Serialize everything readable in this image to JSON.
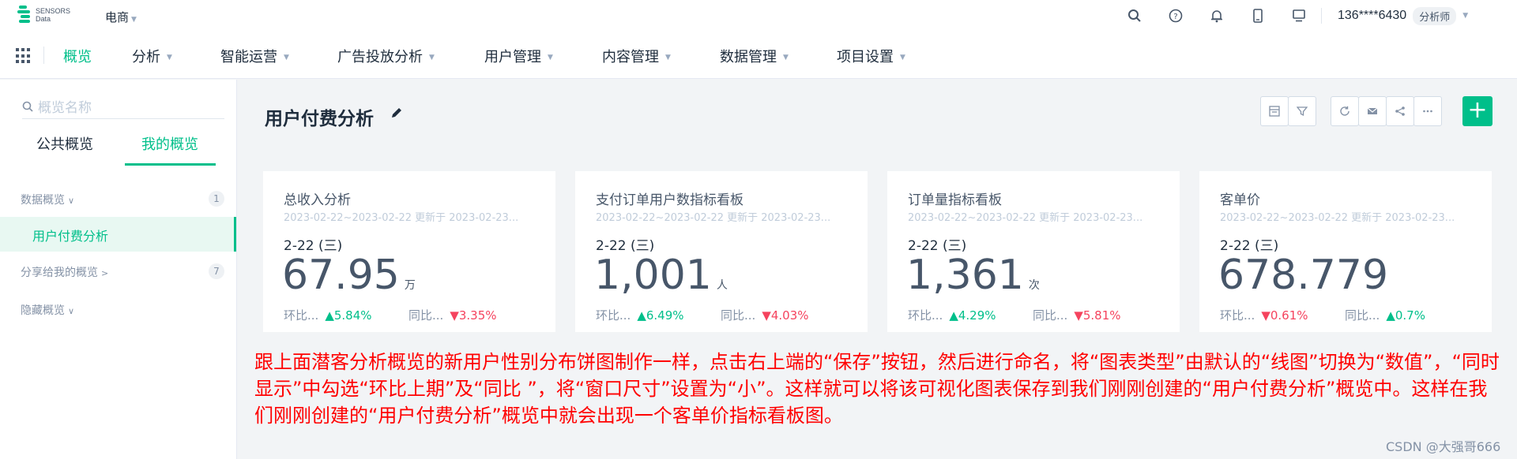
{
  "logo": {
    "line1": "SENSORS",
    "line2": "Data"
  },
  "project": "电商",
  "user": {
    "phone": "136****6430",
    "role": "分析师"
  },
  "top_icons": [
    "search-icon",
    "help-icon",
    "bell-icon",
    "mobile-icon",
    "monitor-icon"
  ],
  "nav": [
    "概览",
    "分析",
    "智能运营",
    "广告投放分析",
    "用户管理",
    "内容管理",
    "数据管理",
    "项目设置"
  ],
  "sidebar": {
    "search_placeholder": "概览名称",
    "tabs": [
      "公共概览",
      "我的概览"
    ],
    "groups": [
      {
        "label": "数据概览",
        "count": "1"
      },
      {
        "label": "分享给我的概览",
        "count": "7"
      },
      {
        "label": "隐藏概览",
        "count": ""
      }
    ],
    "active_item": "用户付费分析"
  },
  "main": {
    "title": "用户付费分析",
    "tools": [
      "layout-icon",
      "filter-icon",
      "refresh-icon",
      "mail-icon",
      "share-icon",
      "more-icon"
    ],
    "add": "+"
  },
  "cards": [
    {
      "title": "总收入分析",
      "date": "2023-02-22~2023-02-22 更新于 2023-02-23...",
      "day": "2-22 (三)",
      "value": "67.95",
      "unit": "万",
      "cmp1_label": "环比...",
      "cmp1_arrow": "▲",
      "cmp1_value": "5.84%",
      "cmp1_dir": "up",
      "cmp2_label": "同比...",
      "cmp2_arrow": "▼",
      "cmp2_value": "3.35%",
      "cmp2_dir": "down"
    },
    {
      "title": "支付订单用户数指标看板",
      "date": "2023-02-22~2023-02-22 更新于 2023-02-23...",
      "day": "2-22 (三)",
      "value": "1,001",
      "unit": "人",
      "cmp1_label": "环比...",
      "cmp1_arrow": "▲",
      "cmp1_value": "6.49%",
      "cmp1_dir": "up",
      "cmp2_label": "同比...",
      "cmp2_arrow": "▼",
      "cmp2_value": "4.03%",
      "cmp2_dir": "down"
    },
    {
      "title": "订单量指标看板",
      "date": "2023-02-22~2023-02-22 更新于 2023-02-23...",
      "day": "2-22 (三)",
      "value": "1,361",
      "unit": "次",
      "cmp1_label": "环比...",
      "cmp1_arrow": "▲",
      "cmp1_value": "4.29%",
      "cmp1_dir": "up",
      "cmp2_label": "同比...",
      "cmp2_arrow": "▼",
      "cmp2_value": "5.81%",
      "cmp2_dir": "down"
    },
    {
      "title": "客单价",
      "date": "2023-02-22~2023-02-22 更新于 2023-02-23...",
      "day": "2-22 (三)",
      "value": "678.779",
      "unit": "",
      "cmp1_label": "环比...",
      "cmp1_arrow": "▼",
      "cmp1_value": "0.61%",
      "cmp1_dir": "down",
      "cmp2_label": "同比...",
      "cmp2_arrow": "▲",
      "cmp2_value": "0.7%",
      "cmp2_dir": "up"
    }
  ],
  "note": "跟上面潜客分析概览的新用户性别分布饼图制作一样，点击右上端的“保存”按钮，然后进行命名，将“图表类型”由默认的“线图”切换为“数值”，“同时显示”中勾选“环比上期”及“同比 ”，将“窗口尺寸”设置为“小”。这样就可以将该可视化图表保存到我们刚刚创建的“用户付费分析”概览中。这样在我们刚刚创建的“用户付费分析”概览中就会出现一个客单价指标看板图。",
  "watermark": "CSDN @大强哥666",
  "colors": {
    "accent": "#00bf8a",
    "up": "#00bf8a",
    "down": "#f5435e",
    "note": "#ff0000"
  }
}
